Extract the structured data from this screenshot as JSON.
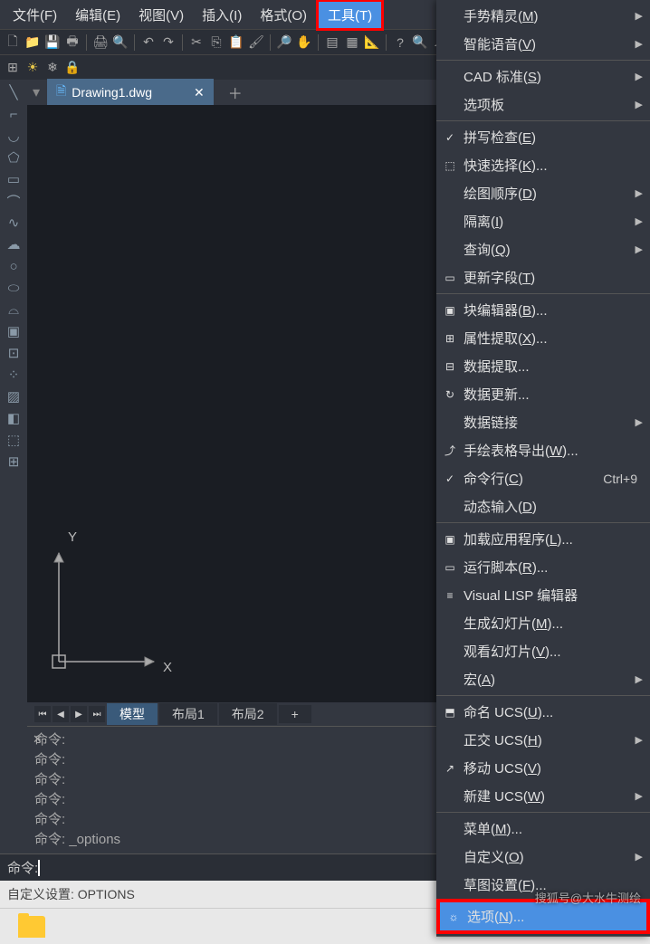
{
  "menubar": {
    "file": "文件(F)",
    "edit": "编辑(E)",
    "view": "视图(V)",
    "insert": "插入(I)",
    "format": "格式(O)",
    "tools": "工具(T)"
  },
  "file_tab": {
    "name": "Drawing1.dwg"
  },
  "layout_tabs": {
    "model": "模型",
    "layout1": "布局1",
    "layout2": "布局2"
  },
  "axes": {
    "x": "X",
    "y": "Y"
  },
  "cmd_history": [
    "命令:",
    "命令:",
    "命令:",
    "命令:",
    "命令:",
    "命令: _options"
  ],
  "cmd_prompt": "命令:",
  "status_bar": "自定义设置: OPTIONS",
  "tools_menu": {
    "groups": [
      [
        {
          "label": "手势精灵(M)",
          "arrow": true
        },
        {
          "label": "智能语音(V)",
          "arrow": true
        }
      ],
      [
        {
          "label": "CAD 标准(S)",
          "arrow": true
        },
        {
          "label": "选项板",
          "arrow": true
        }
      ],
      [
        {
          "label": "拼写检查(E)",
          "icon": "✓"
        },
        {
          "label": "快速选择(K)...",
          "icon": "⬚"
        },
        {
          "label": "绘图顺序(D)",
          "arrow": true
        },
        {
          "label": "隔离(I)",
          "arrow": true
        },
        {
          "label": "查询(Q)",
          "arrow": true
        },
        {
          "label": "更新字段(T)",
          "icon": "▭"
        }
      ],
      [
        {
          "label": "块编辑器(B)...",
          "icon": "▣"
        },
        {
          "label": "属性提取(X)...",
          "icon": "⊞"
        },
        {
          "label": "数据提取...",
          "icon": "⊟"
        },
        {
          "label": "数据更新...",
          "icon": "↻"
        },
        {
          "label": "数据链接",
          "arrow": true
        },
        {
          "label": "手绘表格导出(W)...",
          "icon": "⤴"
        },
        {
          "label": "命令行(C)",
          "icon": "✓",
          "shortcut": "Ctrl+9"
        },
        {
          "label": "动态输入(D)"
        }
      ],
      [
        {
          "label": "加载应用程序(L)...",
          "icon": "▣"
        },
        {
          "label": "运行脚本(R)...",
          "icon": "▭"
        },
        {
          "label": "Visual LISP 编辑器",
          "icon": "≡"
        },
        {
          "label": "生成幻灯片(M)..."
        },
        {
          "label": "观看幻灯片(V)..."
        },
        {
          "label": "宏(A)",
          "arrow": true
        }
      ],
      [
        {
          "label": "命名 UCS(U)...",
          "icon": "⬒"
        },
        {
          "label": "正交 UCS(H)",
          "arrow": true
        },
        {
          "label": "移动 UCS(V)",
          "icon": "↗"
        },
        {
          "label": "新建 UCS(W)",
          "arrow": true
        }
      ],
      [
        {
          "label": "菜单(M)..."
        },
        {
          "label": "自定义(O)",
          "arrow": true
        },
        {
          "label": "草图设置(F)..."
        },
        {
          "label": "选项(N)...",
          "icon": "☼",
          "highlighted": true
        }
      ]
    ]
  },
  "watermark": "搜狐号@大水牛测绘"
}
